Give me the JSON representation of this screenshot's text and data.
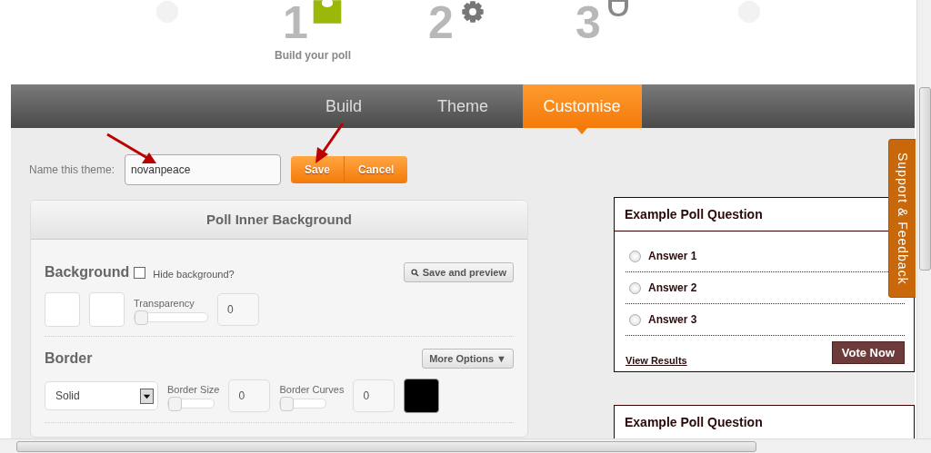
{
  "steps": [
    {
      "kind": "circle",
      "selected": false
    },
    {
      "kind": "puzzle",
      "number": "1",
      "label": "Build your poll",
      "selected": true
    },
    {
      "kind": "gear",
      "number": "2",
      "selected": false
    },
    {
      "kind": "robot",
      "number": "3",
      "selected": false
    },
    {
      "kind": "circle",
      "selected": false
    }
  ],
  "tabs": [
    {
      "label": "Build",
      "selected": false
    },
    {
      "label": "Theme",
      "selected": false
    },
    {
      "label": "Customise",
      "selected": true
    }
  ],
  "theme_name": {
    "label": "Name this theme:",
    "value": "novanpeace"
  },
  "buttons": [
    "Save",
    "Cancel"
  ],
  "panel": {
    "title": "Poll Inner Background",
    "background": {
      "heading": "Background",
      "hide_label": "Hide background?",
      "hide_checked": false,
      "preview_button": "Save and preview",
      "swatches": [
        {
          "color": "#ffffff"
        },
        {
          "color": "#ffffff"
        }
      ],
      "transparency": {
        "label": "Transparency",
        "level": 0,
        "value": "0"
      }
    },
    "border": {
      "heading": "Border",
      "more_button": "More Options ▼",
      "style": "Solid",
      "size": {
        "label": "Border Size",
        "level": 0,
        "value": "0"
      },
      "curves": {
        "label": "Border Curves",
        "level": 0,
        "value": "0"
      },
      "swatch": {
        "color": "#000000"
      }
    }
  },
  "polls": [
    {
      "title": "Example Poll Question",
      "answers": [
        {
          "label": "Answer 1",
          "selected": false
        },
        {
          "label": "Answer 2",
          "selected": false
        },
        {
          "label": "Answer 3",
          "selected": false
        }
      ],
      "link": "View Results",
      "button": "Vote Now"
    },
    {
      "title": "Example Poll Question"
    }
  ],
  "support_tab": "Support & Feedback"
}
